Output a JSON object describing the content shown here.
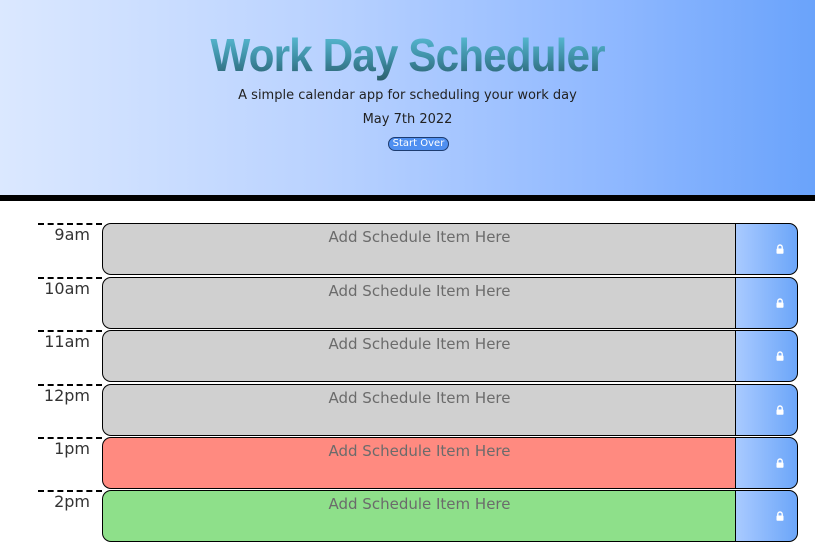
{
  "header": {
    "title": "Work Day Scheduler",
    "subtitle": "A simple calendar app for scheduling your work day",
    "date": "May 7th 2022",
    "start_over_label": "Start Over"
  },
  "colors": {
    "past": "#d0d0d0",
    "present": "#ff8a80",
    "future": "#8ee08a",
    "save_button": "#6ca6f9"
  },
  "schedule": {
    "rows": [
      {
        "hour": "9am",
        "placeholder": "Add Schedule Item Here",
        "state": "past",
        "icon": "lock-icon"
      },
      {
        "hour": "10am",
        "placeholder": "Add Schedule Item Here",
        "state": "past",
        "icon": "lock-icon"
      },
      {
        "hour": "11am",
        "placeholder": "Add Schedule Item Here",
        "state": "past",
        "icon": "lock-icon"
      },
      {
        "hour": "12pm",
        "placeholder": "Add Schedule Item Here",
        "state": "past",
        "icon": "lock-icon"
      },
      {
        "hour": "1pm",
        "placeholder": "Add Schedule Item Here",
        "state": "present",
        "icon": "lock-icon"
      },
      {
        "hour": "2pm",
        "placeholder": "Add Schedule Item Here",
        "state": "future",
        "icon": "lock-icon"
      }
    ]
  }
}
